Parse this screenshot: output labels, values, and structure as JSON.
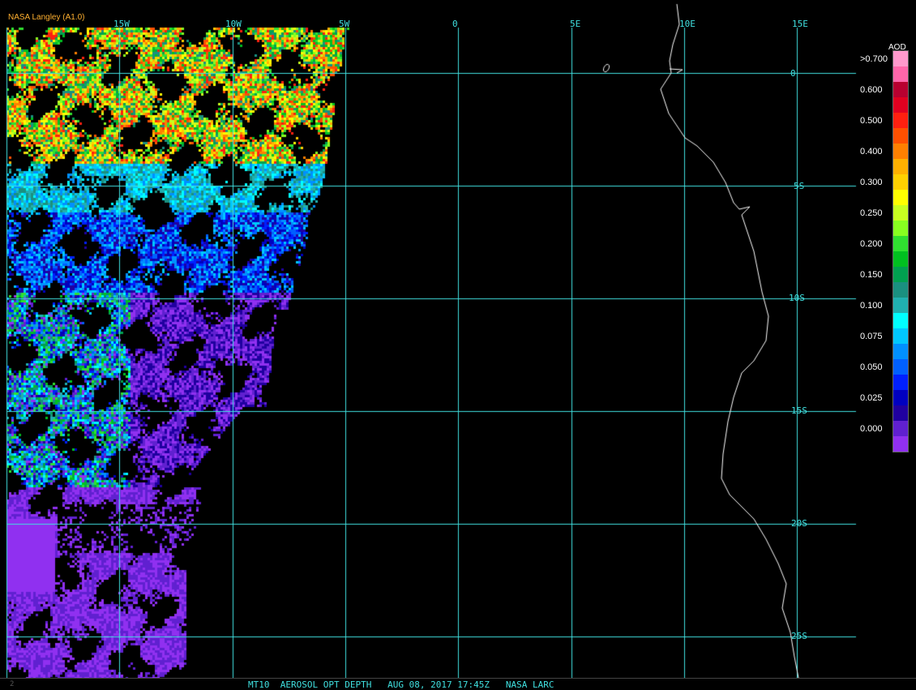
{
  "credit": "NASA Langley (A1.0)",
  "longitude_labels": [
    "15W",
    "10W",
    "5W",
    "0",
    "5E",
    "10E",
    "15E"
  ],
  "latitude_labels": [
    "0",
    "5S",
    "10S",
    "15S",
    "20S",
    "25S"
  ],
  "colorbar": {
    "title": "AOD",
    "labels": [
      ">0.700",
      "0.600",
      "0.500",
      "0.400",
      "0.300",
      "0.250",
      "0.200",
      "0.150",
      "0.100",
      "0.075",
      "0.050",
      "0.025",
      "0.000"
    ],
    "colors": [
      "#ff99cc",
      "#ff66aa",
      "#b80030",
      "#e00020",
      "#ff2010",
      "#ff5000",
      "#ff8000",
      "#ffb000",
      "#ffd000",
      "#ffff00",
      "#c8ff20",
      "#88ff20",
      "#30e030",
      "#00c020",
      "#00a050",
      "#1a9080",
      "#20b0b0",
      "#00ffff",
      "#00c8ff",
      "#0090ff",
      "#0060ff",
      "#0020ff",
      "#0000c0",
      "#2000a0",
      "#6020d0",
      "#9030f0"
    ]
  },
  "status_bar": {
    "index": "2",
    "text": "MT10  AEROSOL OPT DEPTH   AUG 08, 2017 17:45Z   NASA LARC"
  },
  "colors": {
    "grid": "#40e0e0",
    "coast": "#ffffff",
    "background": "#000000"
  }
}
